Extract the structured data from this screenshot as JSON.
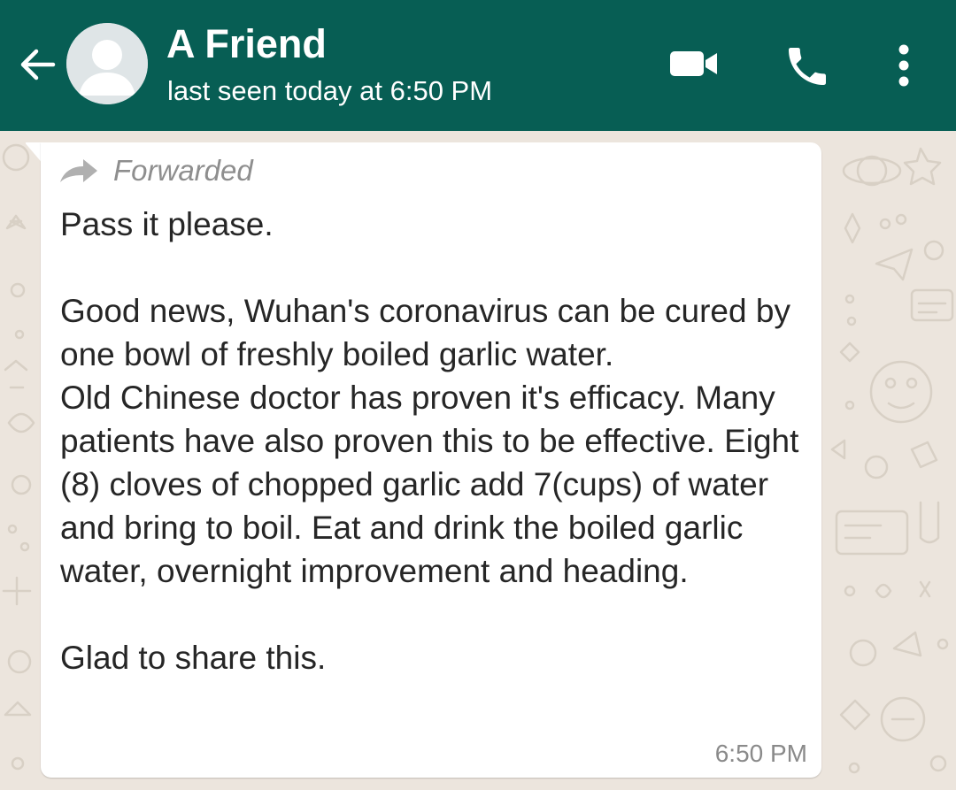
{
  "header": {
    "contact_name": "A Friend",
    "status": "last seen today at 6:50 PM",
    "icons": {
      "back": "arrow-left-icon",
      "avatar": "default-person-icon",
      "video": "video-camera-icon",
      "call": "phone-icon",
      "more": "more-vertical-icon"
    }
  },
  "message": {
    "forwarded_label": "Forwarded",
    "lines": [
      "Pass it please.",
      "",
      "Good news, Wuhan's coronavirus can be cured by one bowl of freshly boiled garlic water.",
      "Old Chinese doctor has proven it's efficacy. Many patients have also proven this to be effective. Eight (8) cloves of chopped garlic add 7(cups) of water and bring to boil. Eat and drink the boiled garlic water, overnight improvement and heading.",
      "",
      "Glad to share this."
    ],
    "time": "6:50 PM"
  },
  "colors": {
    "header_bg": "#075e54",
    "chat_bg": "#ece5dd",
    "bubble_bg": "#ffffff",
    "text": "#262626",
    "muted": "#8e8e8e"
  }
}
